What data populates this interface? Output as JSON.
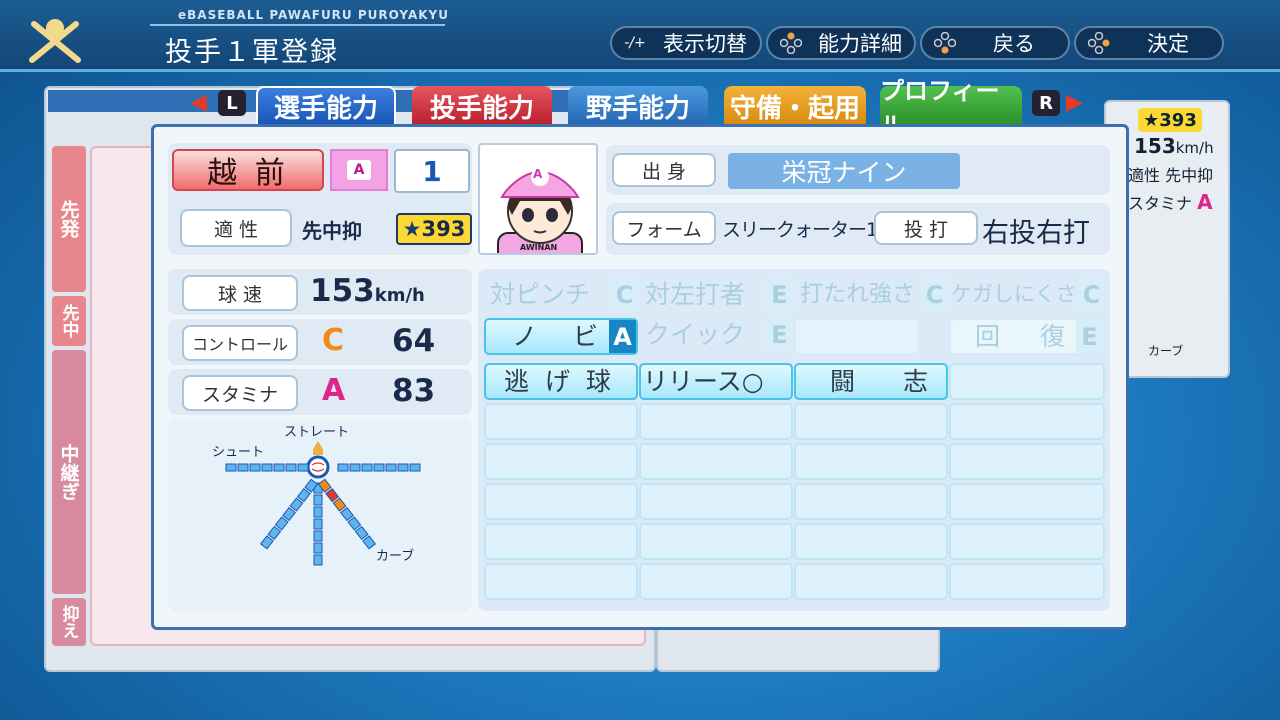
{
  "header": {
    "brand": "eBASEBALL PAWAFURU PUROYAKYU",
    "title": "投手１軍登録"
  },
  "buttons": [
    {
      "icon": "-/+",
      "label": "表示切替"
    },
    {
      "icon": "dpad",
      "label": "能力詳細"
    },
    {
      "icon": "dpad",
      "label": "戻る"
    },
    {
      "icon": "dpad",
      "label": "決定"
    }
  ],
  "tabs": {
    "left_key": "L",
    "right_key": "R",
    "items": [
      "選手能力",
      "投手能力",
      "野手能力",
      "守備・起用",
      "プロフィール"
    ]
  },
  "side_labels": [
    "先発",
    "先中",
    "中継ぎ",
    "抑え"
  ],
  "bg_right": {
    "star": "393",
    "speed": "153",
    "unit": "km/h",
    "aptitude_label": "適性",
    "aptitude": "先中抑",
    "stamina_label": "スタミナ",
    "stamina_rank": "A",
    "curve": "カーブ"
  },
  "player": {
    "name": "越 前",
    "grade": "A",
    "number": "1",
    "aptitude_label": "適 性",
    "aptitude": "先中抑",
    "star": "393",
    "origin_label": "出 身",
    "origin": "栄冠ナイン",
    "form_label": "フォーム",
    "form": "スリークォーター1",
    "bat_label": "投 打",
    "bat": "右投右打",
    "cap_letter": "A",
    "shirt_text": "AWINAN"
  },
  "stats": {
    "speed_label": "球 速",
    "speed": "153",
    "speed_unit": "km/h",
    "control_label": "コントロール",
    "control_rank": "C",
    "control": "64",
    "stamina_label": "スタミナ",
    "stamina_rank": "A",
    "stamina": "83"
  },
  "pitch_chart": {
    "straight": "ストレート",
    "shoot": "シュート",
    "curve": "カーブ",
    "curve_level": 3
  },
  "abilities": {
    "row1": [
      {
        "name": "対ピンチ",
        "grade": "C"
      },
      {
        "name": "対左打者",
        "grade": "E"
      },
      {
        "name": "打たれ強さ",
        "grade": "C"
      },
      {
        "name": "ケガしにくさ",
        "grade": "C"
      }
    ],
    "row2": [
      {
        "name": "ノ ビ",
        "grade": "A"
      },
      {
        "name": "クイック",
        "grade": "E"
      },
      {
        "name": "回 復",
        "grade": "E"
      }
    ],
    "specials": [
      "逃 げ 球",
      "リリース○",
      "闘 志"
    ]
  },
  "colors": {
    "accent": "#1687c4",
    "rankA": "#e0248a",
    "rankC": "#f08a18",
    "rankE": "#555555"
  }
}
